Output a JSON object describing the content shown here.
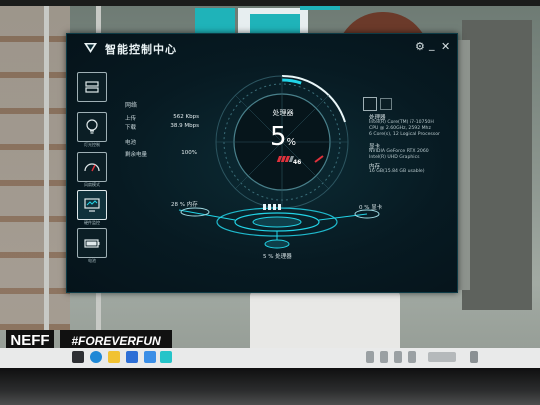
{
  "app": {
    "title": "智能控制中心",
    "settings_icon": "gear-icon",
    "minimize_icon": "minimize-icon",
    "close_icon": "close-icon"
  },
  "sidebar": {
    "items": [
      {
        "name": "performance",
        "icon": "dashboard-list-icon",
        "label": ""
      },
      {
        "name": "lighting",
        "icon": "lightbulb-icon",
        "label": "灯光控制"
      },
      {
        "name": "fan",
        "icon": "speedometer-icon",
        "label": "风扇模式"
      },
      {
        "name": "monitor",
        "icon": "monitor-icon",
        "label": "硬件监控"
      },
      {
        "name": "battery",
        "icon": "battery-icon",
        "label": "电池"
      }
    ]
  },
  "network": {
    "title": "网络",
    "upload_label": "上传",
    "upload_value": "562 Kbps",
    "download_label": "下载",
    "download_value": "38.9 Mbps",
    "power_label": "电池",
    "battery_label": "剩余电量",
    "battery_value": "100%"
  },
  "gauge": {
    "label": "处理器",
    "value": "5",
    "unit": "%",
    "sub_value": "46",
    "fill_fraction": 0.05
  },
  "bottom": {
    "memory_label": "28 % 内存",
    "processor_label": "5 % 处理器",
    "gpu_label": "0 % 显卡"
  },
  "specs": {
    "cpu_title": "处理器",
    "cpu_lines": [
      "Intel(R) Core(TM) i7-10750H",
      "CPU @ 2.60GHz, 2592 Mhz",
      "6 Core(s), 12 Logical Processor"
    ],
    "gpu_title": "显卡",
    "gpu_lines": [
      "NVIDIA GeForce RTX 2060",
      "Intel(R) UHD Graphics"
    ],
    "mem_title": "内存",
    "mem_lines": [
      "16 GB(15.84 GB usable)"
    ]
  },
  "overlay": {
    "neff": "NEFF",
    "forever": "#FOREVERFUN"
  },
  "colors": {
    "accent": "#22d3e6",
    "window_bg": "#071a22",
    "red": "#e0313b"
  }
}
